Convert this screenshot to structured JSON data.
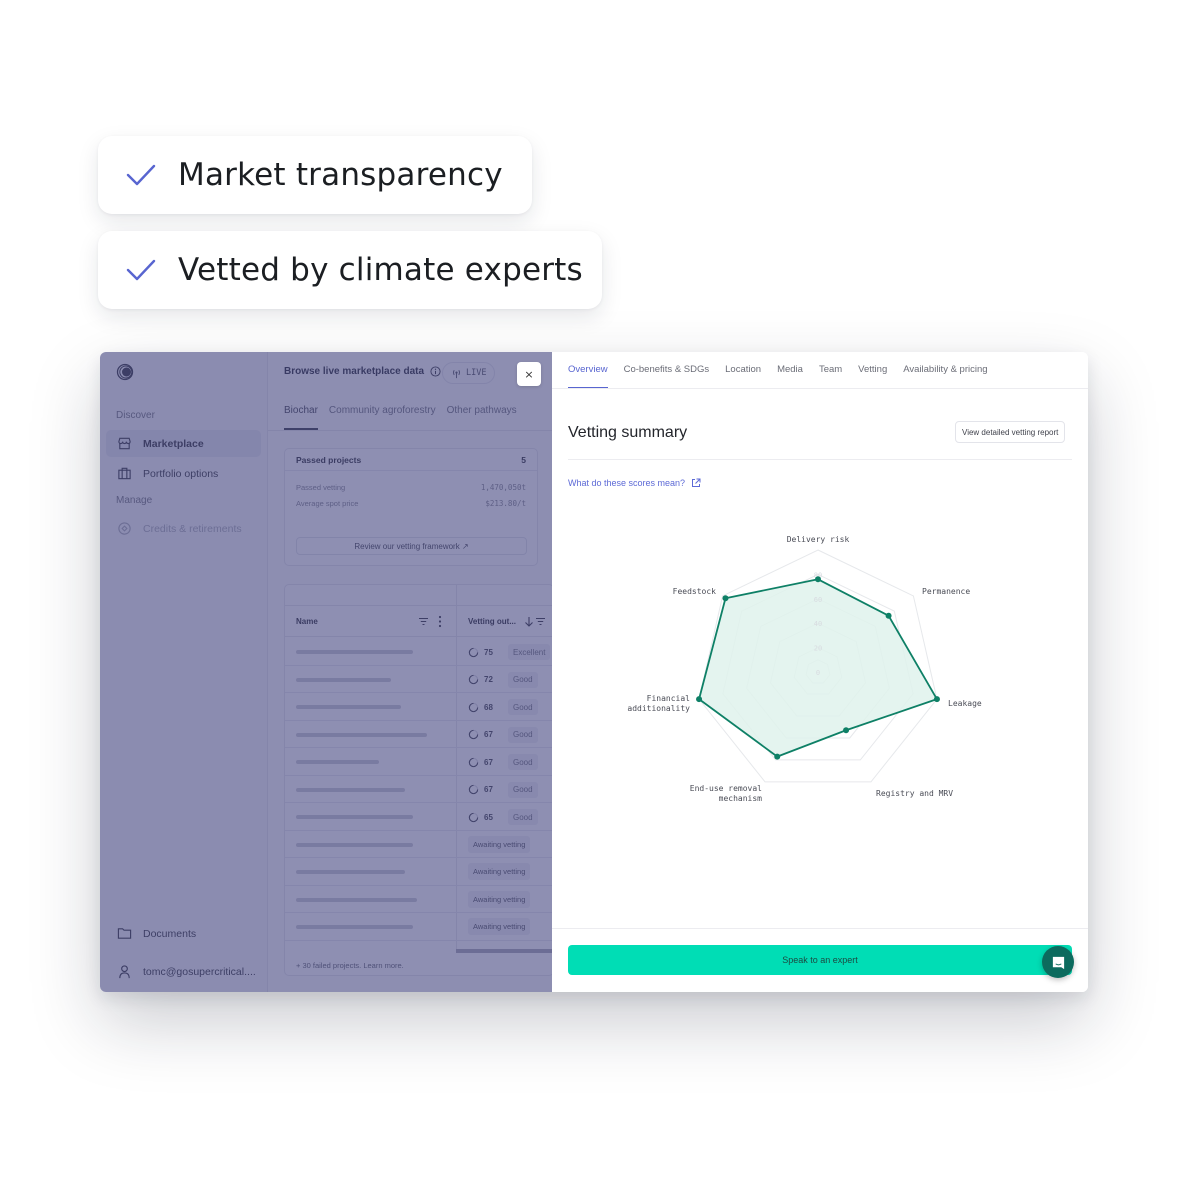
{
  "features": [
    {
      "icon": "check-icon",
      "label": "Market transparency"
    },
    {
      "icon": "check-icon",
      "label": "Vetted by climate experts"
    }
  ],
  "colors": {
    "accent": "#5865d0",
    "radar_stroke": "#0e8066",
    "radar_fill": "#dff2ec",
    "cta": "#00ddb5",
    "chat": "#0c6b5e",
    "overlay": "#484a82"
  },
  "sidebar": {
    "sections": [
      {
        "label": "Discover"
      },
      {
        "label": "Manage"
      }
    ],
    "items": [
      {
        "label": "Marketplace",
        "icon": "storefront-icon",
        "active": true
      },
      {
        "label": "Portfolio options",
        "icon": "briefcase-icon",
        "active": false
      },
      {
        "label": "Credits & retirements",
        "icon": "target-icon",
        "active": false,
        "disabled": true
      }
    ],
    "bottom": [
      {
        "label": "Documents",
        "icon": "folder-icon"
      },
      {
        "label": "tomc@gosupercritical....",
        "icon": "user-icon"
      }
    ]
  },
  "marketplace": {
    "title": "Browse live marketplace data",
    "live_label": "LIVE",
    "tabs": [
      "Biochar",
      "Community agroforestry",
      "Other pathways"
    ],
    "active_tab": 0,
    "passed_card": {
      "title": "Passed projects",
      "count": "5",
      "rows": [
        {
          "label": "Passed vetting",
          "value": "1,470,050t"
        },
        {
          "label": "Average spot price",
          "value": "$213.80/t"
        }
      ],
      "button": "Review our vetting framework ↗"
    },
    "table": {
      "columns": [
        "Name",
        "Vetting out..."
      ],
      "rows": [
        {
          "score": "75",
          "grade": "Excellent"
        },
        {
          "score": "72",
          "grade": "Good"
        },
        {
          "score": "68",
          "grade": "Good"
        },
        {
          "score": "67",
          "grade": "Good"
        },
        {
          "score": "67",
          "grade": "Good"
        },
        {
          "score": "67",
          "grade": "Good"
        },
        {
          "score": "65",
          "grade": "Good"
        },
        {
          "status": "Awaiting vetting"
        },
        {
          "status": "Awaiting vetting"
        },
        {
          "status": "Awaiting vetting"
        },
        {
          "status": "Awaiting vetting"
        }
      ],
      "footer": "+ 30 failed projects.  Learn more."
    },
    "close_label": "×"
  },
  "detail": {
    "tabs": [
      "Overview",
      "Co-benefits & SDGs",
      "Location",
      "Media",
      "Team",
      "Vetting",
      "Availability & pricing"
    ],
    "active_tab": 0,
    "section_title": "Vetting summary",
    "report_button": "View detailed vetting report",
    "scores_link": "What do these scores mean?",
    "cta": "Speak to an expert"
  },
  "chart_data": {
    "type": "radar",
    "title": "Vetting summary",
    "axes": [
      "Delivery risk",
      "Permanence",
      "Leakage",
      "Registry and MRV",
      "End-use removal mechanism",
      "Financial additionality",
      "Feedstock"
    ],
    "axis_labels": [
      [
        "Delivery risk"
      ],
      [
        "Permanence"
      ],
      [
        "Leakage"
      ],
      [
        "Registry and MRV"
      ],
      [
        "End-use removal",
        "mechanism"
      ],
      [
        "Financial",
        "additionality"
      ],
      [
        "Feedstock"
      ]
    ],
    "values": [
      76,
      74,
      100,
      53,
      77,
      100,
      97
    ],
    "range": [
      0,
      100
    ],
    "ring_ticks": [
      0,
      20,
      40,
      60,
      80
    ],
    "grid": true
  }
}
